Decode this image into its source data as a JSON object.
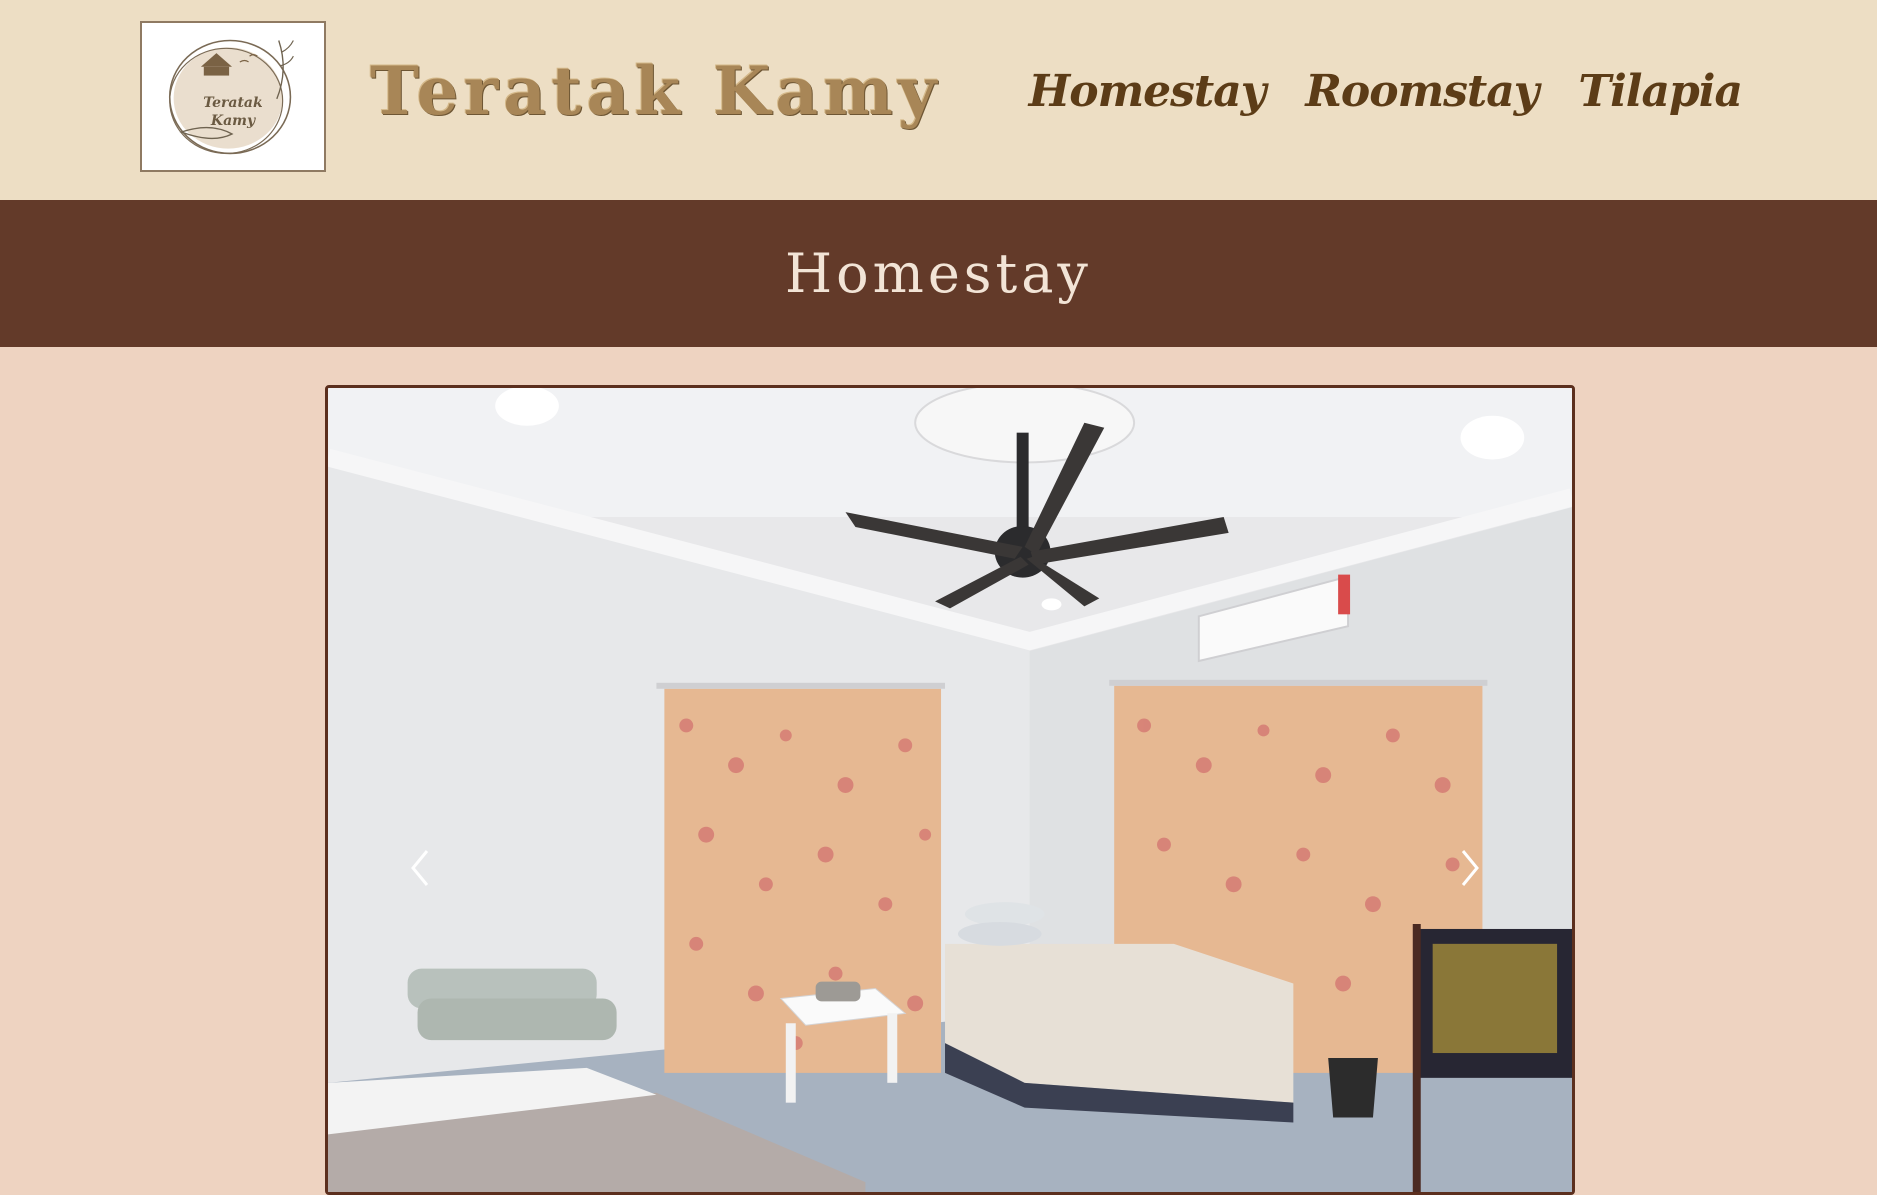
{
  "header": {
    "logo": {
      "line1": "Teratak",
      "line2": "Kamy"
    },
    "site_title": "Teratak Kamy",
    "nav": [
      {
        "label": "Homestay"
      },
      {
        "label": "Roomstay"
      },
      {
        "label": "Tilapia"
      }
    ]
  },
  "banner": {
    "title": "Homestay"
  },
  "carousel": {
    "prev_icon": "chevron-left-icon",
    "next_icon": "chevron-right-icon",
    "slide_description_icon": "bedroom-photo"
  },
  "colors": {
    "header_bg": "#eddec4",
    "banner_bg": "#633a29",
    "page_bg": "#eed3c1",
    "nav_text": "#5c3c17",
    "title_text": "#a88657"
  }
}
